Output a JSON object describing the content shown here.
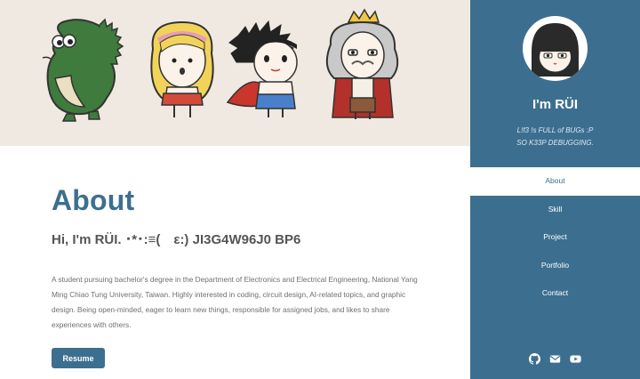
{
  "sidebar": {
    "name": "I'm RÜI",
    "tagline_line1": "L!f3 !s FULL of BUGs :P",
    "tagline_line2": "SO K33P DEBUGGING.",
    "nav": [
      {
        "label": "About",
        "active": true
      },
      {
        "label": "Skill",
        "active": false
      },
      {
        "label": "Project",
        "active": false
      },
      {
        "label": "Portfolio",
        "active": false
      },
      {
        "label": "Contact",
        "active": false
      }
    ],
    "social_icons": [
      "github-icon",
      "mail-icon",
      "youtube-icon"
    ]
  },
  "main": {
    "title": "About",
    "subtitle": "Hi, I'm RÜI.  ･*･:≡(　ε:)  JI3G4W96J0 BP6",
    "description": "A student pursuing bachelor's degree in the Department of Electronics and Electrical Engineering, National Yang Ming Chiao Tung University, Taiwan. Highly interested in coding, circuit design, AI-related topics, and graphic design. Being open-minded, eager to learn new things, responsible for assigned jobs, and likes to share experiences with others.",
    "resume_label": "Resume"
  },
  "colors": {
    "accent": "#3c6f8f",
    "banner_bg": "#efe9e1"
  }
}
